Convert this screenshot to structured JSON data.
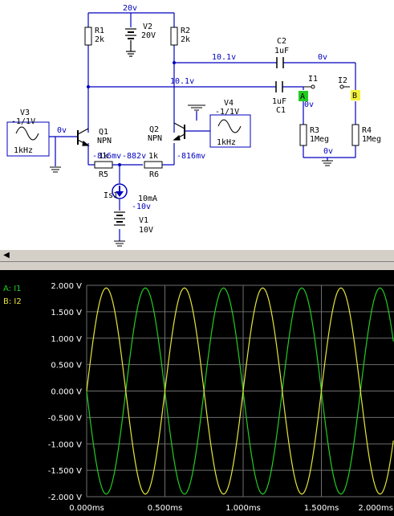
{
  "schematic": {
    "supply_top_label": "20v",
    "v2_name": "V2",
    "v2_value": "20V",
    "r1_name": "R1",
    "r1_value": "2k",
    "r2_name": "R2",
    "r2_value": "2k",
    "c2_name": "C2",
    "c2_value": "1uF",
    "c1_name": "C1",
    "c1_value": "1uF",
    "node_c2_left": "10.1v",
    "node_c2_right": "0v",
    "node_c1_left": "10.1v",
    "probe_i1": "I1",
    "probe_i2": "I2",
    "probe_a": "A",
    "probe_b": "B",
    "node_a": "0v",
    "v3_name": "V3",
    "v3_value": "-1/1V",
    "v3_freq": "1kHz",
    "v4_name": "V4",
    "v4_value": "-1/1V",
    "v4_freq": "1kHz",
    "node_base1": "0v",
    "q1_name": "Q1",
    "q1_type": "NPN",
    "q2_name": "Q2",
    "q2_type": "NPN",
    "r3_name": "R3",
    "r3_value": "1Meg",
    "r4_name": "R4",
    "r4_value": "1Meg",
    "node_r34_bottom": "0v",
    "node_emitter_left": "-816mv",
    "r5_value": "1k",
    "r5_name": "R5",
    "node_mid": "-882v",
    "r6_value": "1k",
    "r6_name": "R6",
    "node_emitter_right": "-816mv",
    "is1_name": "Is1",
    "is1_value": "10mA",
    "node_neg": "-10v",
    "v1_name": "V1",
    "v1_value": "10V"
  },
  "scrollbar": {
    "left_arrow": "◀"
  },
  "scope": {
    "legend": [
      {
        "label": "A: I1",
        "color": "#22cc22"
      },
      {
        "label": "B: I2",
        "color": "#e6e63a"
      }
    ],
    "colors": {
      "background": "#000000",
      "grid": "#6e6e6e",
      "trace_a": "#22cc22",
      "trace_b": "#e6e63a"
    }
  },
  "chart_data": {
    "type": "line",
    "x_unit": "ms",
    "y_unit": "V",
    "xlim": [
      0,
      2.0
    ],
    "ylim": [
      -2.0,
      2.0
    ],
    "x_ticks": [
      "0.000ms",
      "0.500ms",
      "1.000ms",
      "1.500ms",
      "2.000ms"
    ],
    "y_ticks": [
      "2.000 V",
      "1.500 V",
      "1.000 V",
      "0.500 V",
      "0.000 V",
      "-0.500 V",
      "-1.000 V",
      "-1.500 V",
      "-2.000 V"
    ],
    "grid": true,
    "legend_position": "top-left",
    "series": [
      {
        "name": "A: I1",
        "shape": "sine",
        "amplitude": 1.95,
        "frequency_khz": 2,
        "phase_deg": 180
      },
      {
        "name": "B: I2",
        "shape": "sine",
        "amplitude": 1.95,
        "frequency_khz": 2,
        "phase_deg": 0
      }
    ]
  }
}
